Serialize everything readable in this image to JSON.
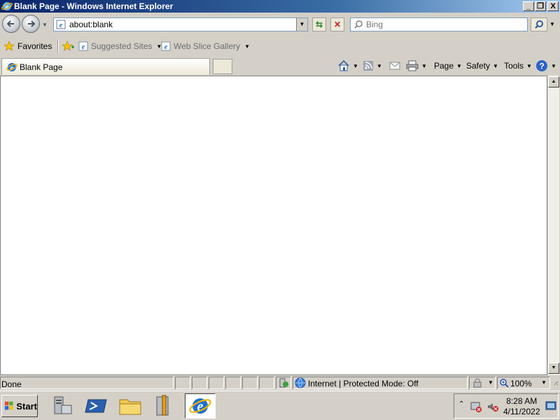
{
  "window": {
    "title": "Blank Page - Windows Internet Explorer",
    "caption_buttons": [
      "_",
      "❐",
      "X"
    ]
  },
  "address_bar": {
    "url": "about:blank",
    "search_placeholder": "Bing"
  },
  "favorites_bar": {
    "favorites_label": "Favorites",
    "links": [
      {
        "label": "Suggested Sites"
      },
      {
        "label": "Web Slice Gallery"
      }
    ]
  },
  "tab": {
    "title": "Blank Page"
  },
  "command_bar": {
    "page_label": "Page",
    "safety_label": "Safety",
    "tools_label": "Tools"
  },
  "status_bar": {
    "status_text": "Done",
    "zone_text": "Internet | Protected Mode: Off",
    "zoom_text": "100%"
  },
  "taskbar": {
    "start_label": "Start",
    "clock_time": "8:28 AM",
    "clock_date": "4/11/2022"
  },
  "colors": {
    "title_gradient_start": "#0a246a",
    "ie_blue": "#1e6fd1",
    "ie_ring": "#f4b400"
  }
}
